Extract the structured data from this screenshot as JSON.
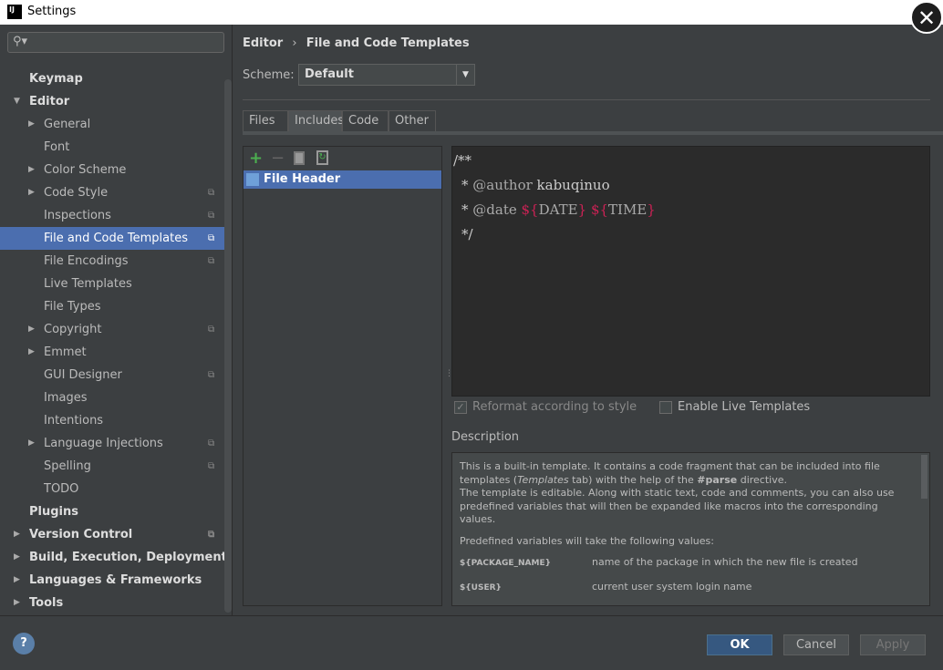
{
  "window": {
    "title": "Settings",
    "icon": "IJ"
  },
  "sidebar": {
    "search_placeholder": "",
    "items": [
      {
        "label": "Keymap",
        "level": 0,
        "bold": true
      },
      {
        "label": "Editor",
        "level": 0,
        "bold": true,
        "expanded": true
      },
      {
        "label": "General",
        "level": 1,
        "arrow": true
      },
      {
        "label": "Font",
        "level": 1
      },
      {
        "label": "Color Scheme",
        "level": 1,
        "arrow": true
      },
      {
        "label": "Code Style",
        "level": 1,
        "arrow": true,
        "copy": true
      },
      {
        "label": "Inspections",
        "level": 1,
        "copy": true
      },
      {
        "label": "File and Code Templates",
        "level": 1,
        "copy": true,
        "selected": true
      },
      {
        "label": "File Encodings",
        "level": 1,
        "copy": true
      },
      {
        "label": "Live Templates",
        "level": 1
      },
      {
        "label": "File Types",
        "level": 1
      },
      {
        "label": "Copyright",
        "level": 1,
        "arrow": true,
        "copy": true
      },
      {
        "label": "Emmet",
        "level": 1,
        "arrow": true
      },
      {
        "label": "GUI Designer",
        "level": 1,
        "copy": true
      },
      {
        "label": "Images",
        "level": 1
      },
      {
        "label": "Intentions",
        "level": 1
      },
      {
        "label": "Language Injections",
        "level": 1,
        "arrow": true,
        "copy": true
      },
      {
        "label": "Spelling",
        "level": 1,
        "copy": true
      },
      {
        "label": "TODO",
        "level": 1
      },
      {
        "label": "Plugins",
        "level": 0,
        "bold": true
      },
      {
        "label": "Version Control",
        "level": 0,
        "bold": true,
        "arrow": true,
        "copy": true
      },
      {
        "label": "Build, Execution, Deployment",
        "level": 0,
        "bold": true,
        "arrow": true
      },
      {
        "label": "Languages & Frameworks",
        "level": 0,
        "bold": true,
        "arrow": true
      },
      {
        "label": "Tools",
        "level": 0,
        "bold": true,
        "arrow": true
      }
    ]
  },
  "breadcrumb": {
    "parent": "Editor",
    "sep": "›",
    "current": "File and Code Templates"
  },
  "scheme": {
    "label": "Scheme:",
    "value": "Default"
  },
  "tabs": [
    "Files",
    "Includes",
    "Code",
    "Other"
  ],
  "active_tab": "Includes",
  "templates": {
    "items": [
      "File Header"
    ]
  },
  "editor": {
    "line1": "/**",
    "line2_star": "* ",
    "line2_tag": "@author",
    "line2_val": " kabuqinuo",
    "line3_star": "* ",
    "line3_tag": "@date",
    "line3_d1": "${",
    "line3_v1": "DATE",
    "line3_d2": "}",
    "line3_d3": "${",
    "line3_v2": "TIME",
    "line3_d4": "}",
    "line4": "*/"
  },
  "options": {
    "reformat": "Reformat according to style",
    "reformat_checked": true,
    "live": "Enable Live Templates",
    "live_checked": false
  },
  "description": {
    "label": "Description",
    "p1a": "This is a built-in template. It contains a code fragment that can be included into file templates (",
    "p1b": "Templates",
    "p1c": " tab) with the help of the ",
    "p1d": "#parse",
    "p1e": " directive.",
    "p2": "The template is editable. Along with static text, code and comments, you can also use predefined variables that will then be expanded like macros into the corresponding values.",
    "p3": "Predefined variables will take the following values:",
    "vars": [
      {
        "name": "${PACKAGE_NAME}",
        "desc": "name of the package in which the new file is created"
      },
      {
        "name": "${USER}",
        "desc": "current user system login name"
      }
    ]
  },
  "buttons": {
    "help": "?",
    "ok": "OK",
    "cancel": "Cancel",
    "apply": "Apply"
  },
  "colors": {
    "selection": "#4b6eaf",
    "primary_button": "#365880",
    "editor_bg": "#2b2b2b",
    "variable": "#cc2255",
    "add": "#4caf50"
  }
}
